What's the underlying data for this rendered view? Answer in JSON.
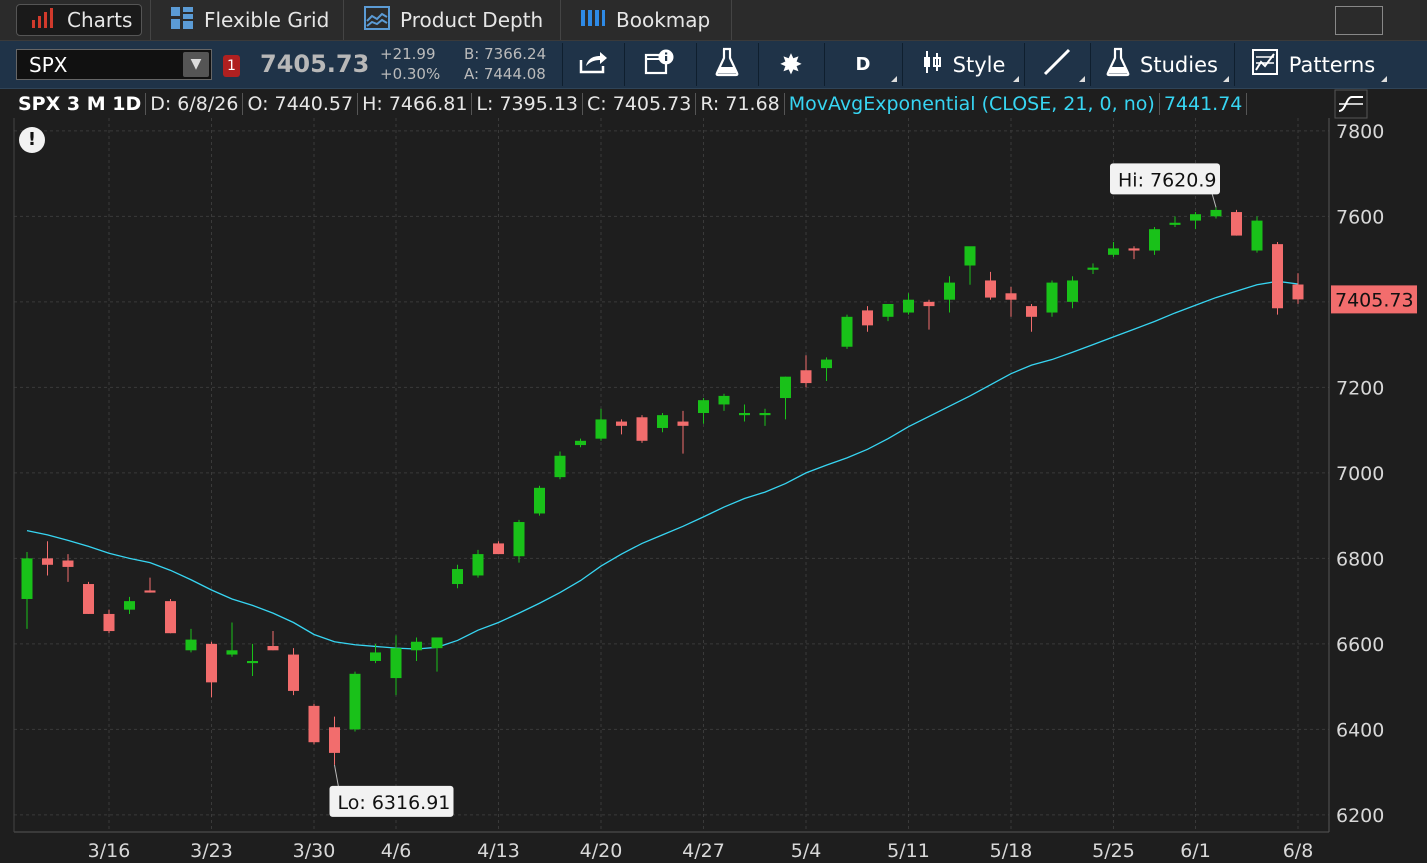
{
  "tabs": [
    {
      "label": "Charts",
      "icon": "bar-chart-icon",
      "active": true
    },
    {
      "label": "Flexible Grid",
      "icon": "grid-icon"
    },
    {
      "label": "Product Depth",
      "icon": "depth-icon"
    },
    {
      "label": "Bookmap",
      "icon": "bookmap-icon"
    }
  ],
  "toolbar": {
    "symbol": "SPX",
    "link_badge": "1",
    "last_price": "7405.73",
    "net_change": "+21.99",
    "pct_change": "+0.30%",
    "bid": "B: 7366.24",
    "ask": "A: 7444.08",
    "aggregation": "D",
    "style_label": "Style",
    "studies_label": "Studies",
    "patterns_label": "Patterns"
  },
  "info": {
    "title": "SPX 3 M 1D",
    "date": "D: 6/8/26",
    "open": "O: 7440.57",
    "high": "H: 7466.81",
    "low": "L: 7395.13",
    "close": "C: 7405.73",
    "range": "R: 71.68",
    "study": "MovAvgExponential (CLOSE, 21, 0, no)",
    "study_value": "7441.74",
    "alert_glyph": "!"
  },
  "chart_data": {
    "type": "candlestick",
    "symbol": "SPX",
    "ylim": [
      6160,
      7830
    ],
    "yticks": [
      6200,
      6400,
      6600,
      6800,
      7000,
      7200,
      7400,
      7600,
      7800
    ],
    "xtick_labels": [
      {
        "label": "3/16",
        "index": 4
      },
      {
        "label": "3/23",
        "index": 9
      },
      {
        "label": "3/30",
        "index": 14
      },
      {
        "label": "4/6",
        "index": 18
      },
      {
        "label": "4/13",
        "index": 23
      },
      {
        "label": "4/20",
        "index": 28
      },
      {
        "label": "4/27",
        "index": 33
      },
      {
        "label": "5/4",
        "index": 38
      },
      {
        "label": "5/11",
        "index": 43
      },
      {
        "label": "5/18",
        "index": 48
      },
      {
        "label": "5/25",
        "index": 53
      },
      {
        "label": "6/1",
        "index": 57
      },
      {
        "label": "6/8",
        "index": 62
      }
    ],
    "colors": {
      "up": "#19c119",
      "down": "#f26d6d",
      "ema": "#37d5f2",
      "grid": "#3a3a3a",
      "last_label": "#f26d6d"
    },
    "candles": [
      {
        "o": 6705,
        "h": 6815,
        "l": 6635,
        "c": 6800
      },
      {
        "o": 6800,
        "h": 6840,
        "l": 6760,
        "c": 6785
      },
      {
        "o": 6795,
        "h": 6810,
        "l": 6745,
        "c": 6780
      },
      {
        "o": 6740,
        "h": 6745,
        "l": 6670,
        "c": 6670
      },
      {
        "o": 6670,
        "h": 6680,
        "l": 6625,
        "c": 6630
      },
      {
        "o": 6680,
        "h": 6710,
        "l": 6670,
        "c": 6700
      },
      {
        "o": 6725,
        "h": 6755,
        "l": 6720,
        "c": 6720
      },
      {
        "o": 6700,
        "h": 6705,
        "l": 6625,
        "c": 6625
      },
      {
        "o": 6585,
        "h": 6635,
        "l": 6580,
        "c": 6610
      },
      {
        "o": 6600,
        "h": 6605,
        "l": 6475,
        "c": 6510
      },
      {
        "o": 6575,
        "h": 6650,
        "l": 6570,
        "c": 6585
      },
      {
        "o": 6555,
        "h": 6600,
        "l": 6525,
        "c": 6560
      },
      {
        "o": 6595,
        "h": 6630,
        "l": 6585,
        "c": 6585
      },
      {
        "o": 6575,
        "h": 6590,
        "l": 6480,
        "c": 6490
      },
      {
        "o": 6455,
        "h": 6460,
        "l": 6365,
        "c": 6370
      },
      {
        "o": 6405,
        "h": 6430,
        "l": 6316.91,
        "c": 6345
      },
      {
        "o": 6400,
        "h": 6535,
        "l": 6395,
        "c": 6530
      },
      {
        "o": 6560,
        "h": 6600,
        "l": 6555,
        "c": 6580
      },
      {
        "o": 6520,
        "h": 6620,
        "l": 6480,
        "c": 6590
      },
      {
        "o": 6585,
        "h": 6615,
        "l": 6560,
        "c": 6605
      },
      {
        "o": 6590,
        "h": 6615,
        "l": 6535,
        "c": 6615
      },
      {
        "o": 6740,
        "h": 6785,
        "l": 6730,
        "c": 6775
      },
      {
        "o": 6760,
        "h": 6820,
        "l": 6755,
        "c": 6810
      },
      {
        "o": 6835,
        "h": 6840,
        "l": 6810,
        "c": 6810
      },
      {
        "o": 6805,
        "h": 6890,
        "l": 6790,
        "c": 6885
      },
      {
        "o": 6905,
        "h": 6970,
        "l": 6900,
        "c": 6965
      },
      {
        "o": 6990,
        "h": 7050,
        "l": 6985,
        "c": 7040
      },
      {
        "o": 7065,
        "h": 7080,
        "l": 7060,
        "c": 7075
      },
      {
        "o": 7080,
        "h": 7150,
        "l": 7075,
        "c": 7125
      },
      {
        "o": 7120,
        "h": 7125,
        "l": 7090,
        "c": 7110
      },
      {
        "o": 7130,
        "h": 7135,
        "l": 7070,
        "c": 7075
      },
      {
        "o": 7105,
        "h": 7140,
        "l": 7095,
        "c": 7135
      },
      {
        "o": 7120,
        "h": 7145,
        "l": 7045,
        "c": 7110
      },
      {
        "o": 7140,
        "h": 7175,
        "l": 7115,
        "c": 7170
      },
      {
        "o": 7160,
        "h": 7185,
        "l": 7145,
        "c": 7180
      },
      {
        "o": 7135,
        "h": 7160,
        "l": 7120,
        "c": 7140
      },
      {
        "o": 7135,
        "h": 7150,
        "l": 7110,
        "c": 7140
      },
      {
        "o": 7175,
        "h": 7225,
        "l": 7125,
        "c": 7225
      },
      {
        "o": 7240,
        "h": 7275,
        "l": 7200,
        "c": 7210
      },
      {
        "o": 7245,
        "h": 7270,
        "l": 7215,
        "c": 7265
      },
      {
        "o": 7295,
        "h": 7370,
        "l": 7290,
        "c": 7365
      },
      {
        "o": 7380,
        "h": 7390,
        "l": 7330,
        "c": 7345
      },
      {
        "o": 7365,
        "h": 7395,
        "l": 7355,
        "c": 7395
      },
      {
        "o": 7375,
        "h": 7420,
        "l": 7370,
        "c": 7405
      },
      {
        "o": 7400,
        "h": 7405,
        "l": 7335,
        "c": 7390
      },
      {
        "o": 7405,
        "h": 7460,
        "l": 7375,
        "c": 7445
      },
      {
        "o": 7485,
        "h": 7520,
        "l": 7440,
        "c": 7530
      },
      {
        "o": 7450,
        "h": 7470,
        "l": 7405,
        "c": 7410
      },
      {
        "o": 7420,
        "h": 7435,
        "l": 7365,
        "c": 7405
      },
      {
        "o": 7390,
        "h": 7395,
        "l": 7330,
        "c": 7365
      },
      {
        "o": 7375,
        "h": 7450,
        "l": 7365,
        "c": 7445
      },
      {
        "o": 7400,
        "h": 7460,
        "l": 7385,
        "c": 7450
      },
      {
        "o": 7475,
        "h": 7490,
        "l": 7465,
        "c": 7480
      },
      {
        "o": 7510,
        "h": 7540,
        "l": 7505,
        "c": 7525
      },
      {
        "o": 7525,
        "h": 7530,
        "l": 7500,
        "c": 7520
      },
      {
        "o": 7520,
        "h": 7575,
        "l": 7510,
        "c": 7570
      },
      {
        "o": 7580,
        "h": 7600,
        "l": 7575,
        "c": 7585
      },
      {
        "o": 7590,
        "h": 7610,
        "l": 7570,
        "c": 7605
      },
      {
        "o": 7600,
        "h": 7620.9,
        "l": 7595,
        "c": 7615
      },
      {
        "o": 7610,
        "h": 7615,
        "l": 7555,
        "c": 7555
      },
      {
        "o": 7520,
        "h": 7600,
        "l": 7515,
        "c": 7590
      },
      {
        "o": 7535,
        "h": 7540,
        "l": 7370,
        "c": 7385
      },
      {
        "o": 7440.57,
        "h": 7466.81,
        "l": 7395.13,
        "c": 7405.73
      }
    ],
    "ema_series": {
      "name": "MovAvgExponential (CLOSE, 21, 0, no)",
      "values": [
        6865,
        6855,
        6842,
        6828,
        6812,
        6800,
        6790,
        6772,
        6750,
        6726,
        6705,
        6690,
        6672,
        6650,
        6622,
        6605,
        6598,
        6594,
        6590,
        6588,
        6592,
        6608,
        6632,
        6650,
        6672,
        6695,
        6720,
        6748,
        6782,
        6810,
        6835,
        6855,
        6875,
        6897,
        6920,
        6940,
        6955,
        6975,
        7000,
        7018,
        7035,
        7055,
        7080,
        7108,
        7132,
        7156,
        7180,
        7206,
        7232,
        7252,
        7265,
        7282,
        7300,
        7318,
        7336,
        7354,
        7374,
        7392,
        7410,
        7425,
        7440,
        7448,
        7441.74
      ]
    },
    "hi_label": "Hi: 7620.9",
    "lo_label": "Lo: 6316.91",
    "last_label": "7405.73"
  }
}
